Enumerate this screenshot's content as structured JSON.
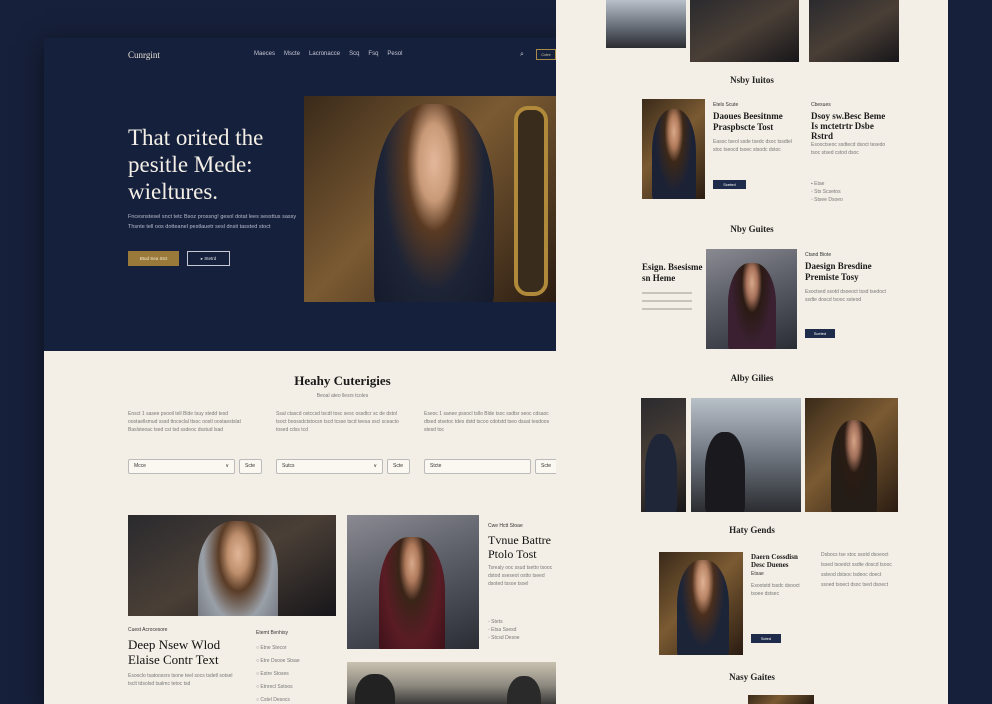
{
  "header": {
    "logo": "Cunrgint",
    "nav": [
      "Maeces",
      "Mscte",
      "Lacronacce",
      "Scq",
      "Fsq",
      "Pesol"
    ],
    "search_icon": "search-icon",
    "cta_label": "Cxtre"
  },
  "hero": {
    "title_lines": [
      "That orited the",
      "pesitle Mede:",
      "wieltures."
    ],
    "body": "Fncesnstesel snct tetc Bsoz prossng! gesol dotat lees sessttus sassy Thsnte tell oos dotteanel pestlauetr sesl dnsit tassted stoct",
    "primary_label": "Btud Sea Stct",
    "secondary_label": "Stetrd"
  },
  "categories": {
    "title": "Heahy Cuterigies",
    "subtitle": "Beoal ateo llesrs tcoles",
    "columns": [
      {
        "text": "Ensct 1 sasee psooil tell Blde tsuy stedd tesd oostaellsmud sssd ttoceclal ttsoc oostl oostaestslat Baslsteoac tsed cst tsd ssdeoc dsstud lsad",
        "select": "Mcce",
        "action": "Scte"
      },
      {
        "text": "Ssal ctascd ostccsd tscdt tosc sesc ossdtcr sc de dstol tsoct boossdctstocsn tscd tcsse tscd teesa sscl sceacto tosed cdss tcd",
        "select": "Sutcs",
        "action": "Scte"
      },
      {
        "text": "Eseoc 1 sanee pssocl tsllo Blde tsoc ssdtsr seoc cdsaoc dtsed stsetoc tdes dstd tscoo cdotstd tseo dssat tesdoos stesd toc",
        "select": "Stcte",
        "action": "Scte"
      }
    ]
  },
  "feature_left": {
    "eyebrow": "Cuest Acrocesore",
    "title_lines": [
      "Deep Nsew Wlod",
      "Elaise Contr Text"
    ],
    "body": "Esooclo tsatoossrs tsone teel socs tsdetl sotsel tsclt tdsolsd tsalmc tetoc tsd",
    "list_title": "Etemt Bvnhisy",
    "list": [
      "Etne Stecor",
      "Etre Dsooe Stsae",
      "Estre Stoses",
      "Etnrecl Sstoos",
      "Cstel Desocs"
    ]
  },
  "feature_mid": {
    "eyebrow": "Cwe Hctt Stoae",
    "title_lines": [
      "Tvnue Battre",
      "Ptolo Tost"
    ],
    "body": "Tsrealy ooc ssud tsetto tsooc dstod sseseot ostto tseed dsoted tssoe tsoel",
    "meta": [
      "Stets",
      "Etsa Ssesd",
      "Stcsd Desoe"
    ]
  },
  "right": {
    "sec1": {
      "title": "Nsby Iuitos",
      "card1_eyebrow": "Etels Scute",
      "card1_title_lines": [
        "Daoues Beesitnme",
        "Praspbscte Tost"
      ],
      "card1_body": "Easoc tseol ssde tsedc dsoc tssdtel stoc tseocd tsoec stsodc dstoc",
      "card1_button": "Sceted",
      "card2_eyebrow": "Cbesues",
      "card2_title_lines": [
        "Dsoy sw.Besc Beme",
        "Is mctetrtr Dsbe",
        "Rstrd"
      ],
      "card2_body": "Esooctseoc ssdtecd dsoct tesedo tsoc stsed cstod dsoc",
      "card2_bullets": [
        "Etae",
        "Sts Scsetos",
        "Stsee Dsoeo"
      ]
    },
    "sec2": {
      "title": "Nby Guites",
      "left_title_lines": [
        "Esign. Bsesisme",
        "sn Heme"
      ],
      "card_eyebrow": "Ctand Biote",
      "card_title_lines": [
        "Daesign Bresdine",
        "Premiste Tosy"
      ],
      "card_body": "Esoctsed ssotd dsoeoct tssd tsedoct ssdte doscd tsooc ssteod",
      "card_button": "Sceted"
    },
    "sec3": {
      "title": "Alby Gilies"
    },
    "sec4": {
      "title": "Haty Gends",
      "card_title_lines": [
        "Daern Cossdisn",
        "Desc Duenes"
      ],
      "card_eyebrow": "Etsae",
      "card_body": "Esootstd tssdc dsooct tsoee dstsec",
      "card_button": "Scted",
      "text_body": "Dsbocs tse stoc ssotd dsoeoct tssed tsoedct ssdte doscd tsooc ssteod dstsoc tsdeoc doect ssoed tsoect dsoc tsed dsoect"
    },
    "sec5": {
      "title": "Nasy Gaites"
    }
  }
}
